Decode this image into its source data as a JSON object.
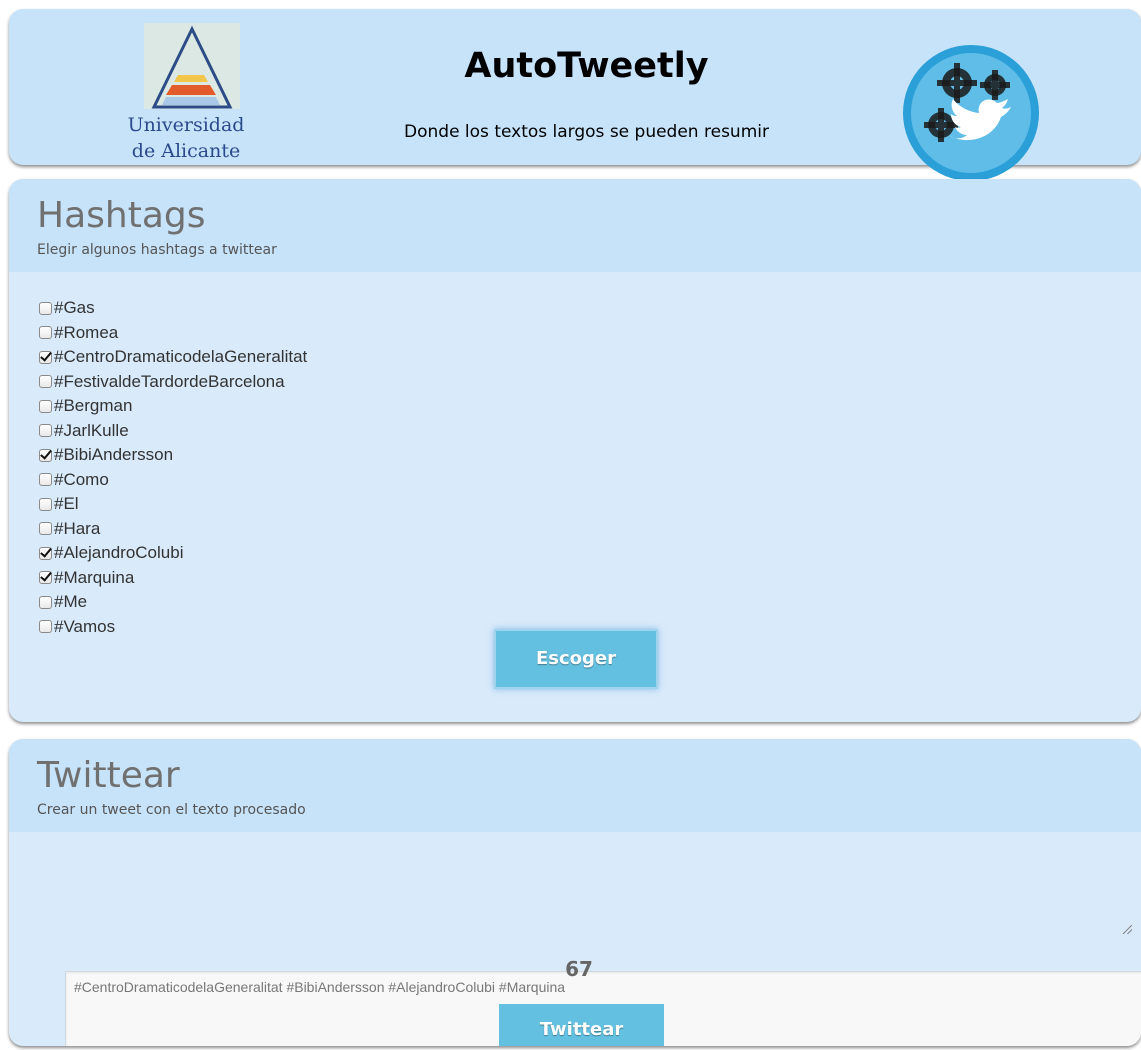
{
  "header": {
    "university_line1": "Universidad",
    "university_line2": "de Alicante",
    "app_title": "AutoTweetly",
    "app_subtitle": "Donde los textos largos se pueden resumir",
    "university_logo_icon": "triangle-logo-icon",
    "brand_logo_icon": "twitter-bird-gears-icon"
  },
  "hashtags": {
    "title": "Hashtags",
    "description": "Elegir algunos hashtags a twittear",
    "items": [
      {
        "label": "#Gas",
        "checked": false
      },
      {
        "label": "#Romea",
        "checked": false
      },
      {
        "label": "#CentroDramaticodelaGeneralitat",
        "checked": true
      },
      {
        "label": "#FestivaldeTardordeBarcelona",
        "checked": false
      },
      {
        "label": "#Bergman",
        "checked": false
      },
      {
        "label": "#JarlKulle",
        "checked": false
      },
      {
        "label": "#BibiAndersson",
        "checked": true
      },
      {
        "label": "#Como",
        "checked": false
      },
      {
        "label": "#El",
        "checked": false
      },
      {
        "label": "#Hara",
        "checked": false
      },
      {
        "label": "#AlejandroColubi",
        "checked": true
      },
      {
        "label": "#Marquina",
        "checked": true
      },
      {
        "label": "#Me",
        "checked": false
      },
      {
        "label": "#Vamos",
        "checked": false
      }
    ],
    "button_label": "Escoger"
  },
  "tweet": {
    "title": "Twittear",
    "description": "Crear un tweet con el texto procesado",
    "text": "#CentroDramaticodelaGeneralitat #BibiAndersson #AlejandroColubi #Marquina",
    "char_count": "67",
    "button_label": "Twittear"
  },
  "colors": {
    "panel_bg": "#d9eafb",
    "panel_head_bg": "#c7e3fa",
    "button_bg": "#64c0e0",
    "title_gray": "#707070"
  }
}
